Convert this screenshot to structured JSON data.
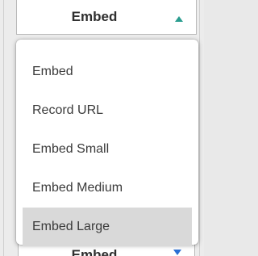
{
  "select_top": {
    "value": "Embed",
    "arrow_icon": "caret-up-icon",
    "arrow_color": "#2a9d8f"
  },
  "dropdown": {
    "items": [
      {
        "label": "Embed",
        "selected": false
      },
      {
        "label": "Record URL",
        "selected": false
      },
      {
        "label": "Embed Small",
        "selected": false
      },
      {
        "label": "Embed Medium",
        "selected": false
      },
      {
        "label": "Embed Large",
        "selected": true
      }
    ],
    "highlight_color": "#d9d9d9"
  },
  "select_bottom": {
    "value": "Embed",
    "arrow_icon": "caret-down-icon",
    "arrow_color": "#2a6fd4"
  }
}
